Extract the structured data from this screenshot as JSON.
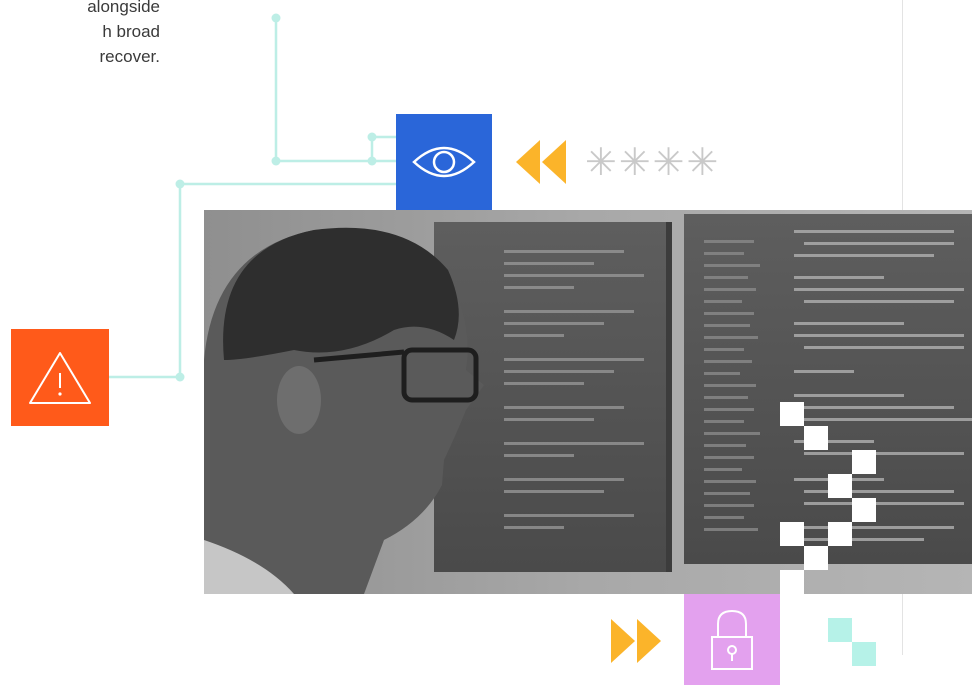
{
  "intro": {
    "lines": [
      "alongside",
      "h broad",
      "recover."
    ]
  },
  "icons": {
    "eye": "eye-icon",
    "warning": "warning-icon",
    "lock": "lock-icon",
    "rewind": "rewind-icon",
    "fast_forward": "fast-forward-icon",
    "asterisk": "asterisk-icon"
  },
  "password_mask": "****",
  "colors": {
    "eye_tile": "#2a66d9",
    "warning_tile": "#ff5a1a",
    "lock_tile": "#e3a1ee",
    "arrows": "#fbb42a",
    "circuit": "#bdeee6",
    "squares_white": "#ffffff",
    "squares_mint": "#b6f2e8",
    "asterisk": "#c9c9c9"
  }
}
